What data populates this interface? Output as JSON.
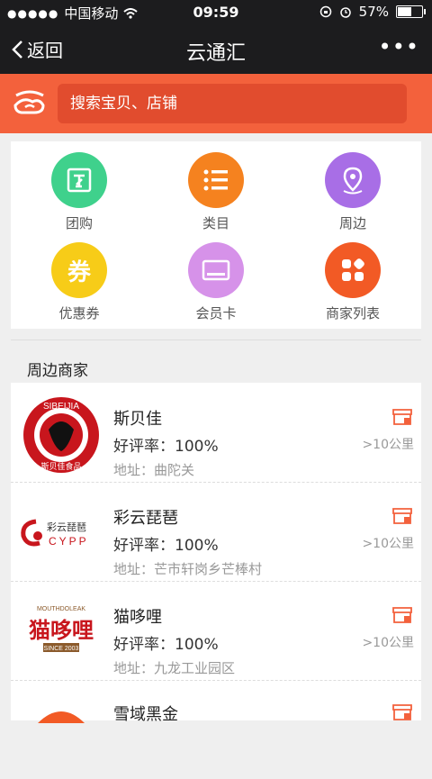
{
  "status": {
    "carrier": "中国移动",
    "time": "09:59",
    "battery": "57%"
  },
  "nav": {
    "back": "返回",
    "title": "云通汇",
    "more": "•••"
  },
  "search": {
    "placeholder": "搜索宝贝、店铺"
  },
  "menu": [
    {
      "label": "团购",
      "color": "#3fd18c",
      "icon": "group-buy-icon"
    },
    {
      "label": "类目",
      "color": "#f5821f",
      "icon": "category-list-icon"
    },
    {
      "label": "周边",
      "color": "#a86ee6",
      "icon": "location-pin-icon"
    },
    {
      "label": "优惠券",
      "color": "#f7cc18",
      "icon": "coupon-icon"
    },
    {
      "label": "会员卡",
      "color": "#d692e9",
      "icon": "member-card-icon"
    },
    {
      "label": "商家列表",
      "color": "#f25a25",
      "icon": "merchant-list-icon"
    }
  ],
  "section": {
    "title": "周边商家"
  },
  "merchants": [
    {
      "name": "斯贝佳",
      "rate": "好评率：100%",
      "addr": "地址：曲陀关",
      "dist": ">10公里"
    },
    {
      "name": "彩云琵琶",
      "rate": "好评率：100%",
      "addr": "地址：芒市轩岗乡芒棒村",
      "dist": ">10公里"
    },
    {
      "name": "猫哆哩",
      "rate": "好评率：100%",
      "addr": "地址：九龙工业园区",
      "dist": ">10公里"
    },
    {
      "name": "雪域黑金",
      "rate": "",
      "addr": "",
      "dist": ""
    }
  ],
  "logos": {
    "sibeijia_top": "SIBEIJIA",
    "sibeijia_bottom": "斯贝佳食品",
    "cypp_cn": "彩云琵琶",
    "cypp_en": "CYPP",
    "maoduoli_en": "MOUTHDOLEAK",
    "maoduoli_cn": "猫哆哩",
    "maoduoli_since": "SINCE 2003"
  },
  "colors": {
    "accent": "#f3613c",
    "dark": "#1c1c1e"
  }
}
